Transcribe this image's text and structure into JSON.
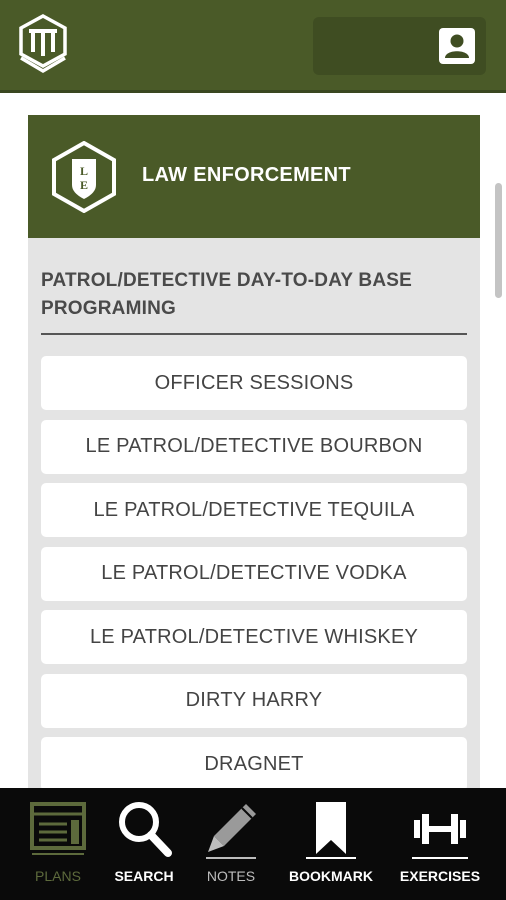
{
  "header": {
    "logo_icon": "shield-logo-icon",
    "profile_icon": "person-badge-icon",
    "bar_color": "#4a5a28"
  },
  "card": {
    "title": "LAW ENFORCEMENT",
    "badge_icon": "le-shield-icon",
    "section_title": "PATROL/DETECTIVE DAY-TO-DAY BASE PROGRAMING",
    "items": [
      {
        "label": "OFFICER SESSIONS"
      },
      {
        "label": "LE PATROL/DETECTIVE BOURBON"
      },
      {
        "label": "LE PATROL/DETECTIVE TEQUILA"
      },
      {
        "label": "LE PATROL/DETECTIVE VODKA"
      },
      {
        "label": "LE PATROL/DETECTIVE WHISKEY"
      },
      {
        "label": "DIRTY HARRY"
      },
      {
        "label": "DRAGNET"
      }
    ]
  },
  "nav": {
    "items": [
      {
        "label": "PLANS",
        "icon": "plans-icon",
        "active": true
      },
      {
        "label": "SEARCH",
        "icon": "search-icon"
      },
      {
        "label": "NOTES",
        "icon": "pencil-icon"
      },
      {
        "label": "BOOKMARK",
        "icon": "bookmark-icon"
      },
      {
        "label": "EXERCISES",
        "icon": "dumbbell-icon"
      }
    ]
  }
}
